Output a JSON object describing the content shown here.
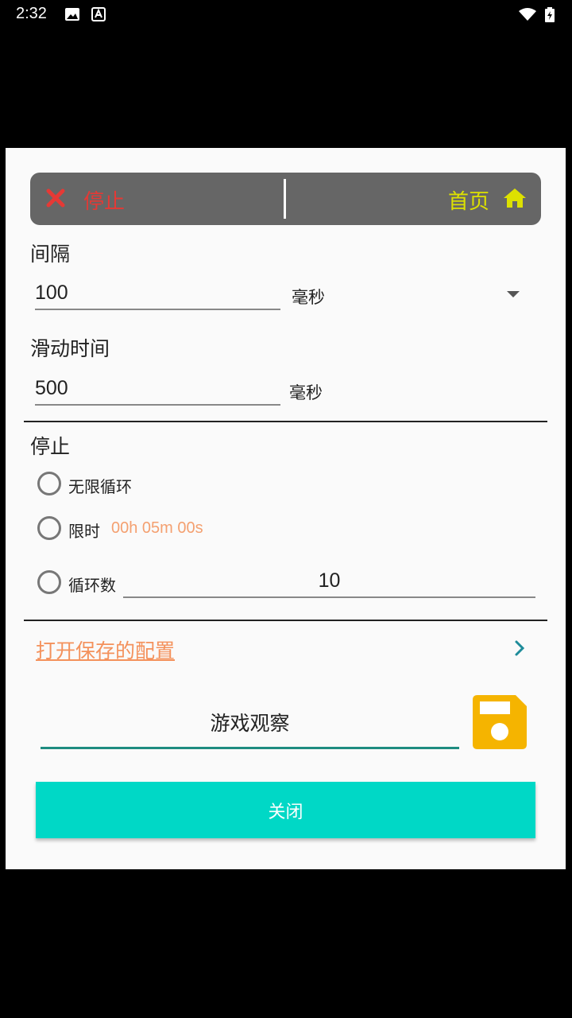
{
  "status_bar": {
    "time": "2:32"
  },
  "topbar": {
    "stop_label": "停止",
    "home_label": "首页"
  },
  "interval": {
    "label": "间隔",
    "value": "100",
    "unit": "毫秒"
  },
  "swipe": {
    "label": "滑动时间",
    "value": "500",
    "unit": "毫秒"
  },
  "stop_section": {
    "label": "停止",
    "options": [
      {
        "label": "无限循环"
      },
      {
        "label": "限时",
        "extra": "00h 05m 00s"
      },
      {
        "label": "循环数",
        "value": "10"
      }
    ]
  },
  "config": {
    "open_label": "打开保存的配置",
    "name_value": "游戏观察"
  },
  "close_label": "关闭",
  "colors": {
    "stop_red": "#e53935",
    "home_yellow": "#dde100",
    "link_orange": "#f4915b",
    "save_yellow": "#f5b400",
    "close_teal": "#00d8c6",
    "chevron_teal": "#1e8c9a"
  }
}
